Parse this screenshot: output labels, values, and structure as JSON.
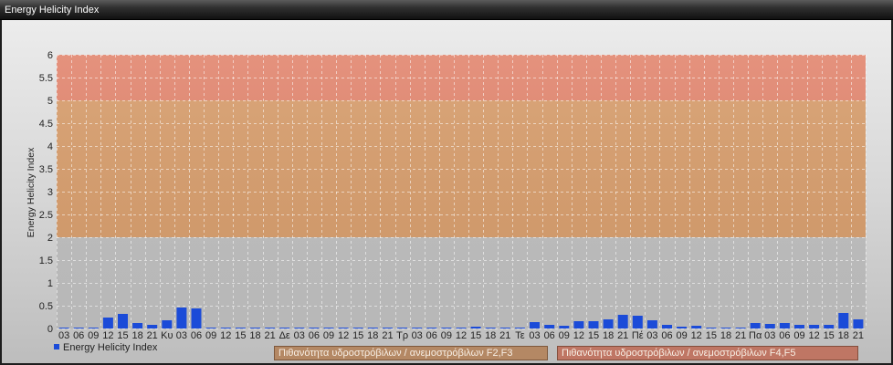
{
  "chart_data": {
    "type": "bar",
    "title": "Energy Helicity Index",
    "ylabel": "Energy Helicity Index",
    "ylim": [
      0,
      6
    ],
    "yticks": [
      0,
      0.5,
      1,
      1.5,
      2,
      2.5,
      3,
      3.5,
      4,
      4.5,
      5,
      5.5,
      6
    ],
    "categories": [
      "03",
      "06",
      "09",
      "12",
      "15",
      "18",
      "21",
      "Κυ",
      "03",
      "06",
      "09",
      "12",
      "15",
      "18",
      "21",
      "Δε",
      "03",
      "06",
      "09",
      "12",
      "15",
      "18",
      "21",
      "Τρ",
      "03",
      "06",
      "09",
      "12",
      "15",
      "18",
      "21",
      "Τε",
      "03",
      "06",
      "09",
      "12",
      "15",
      "18",
      "21",
      "Πέ",
      "03",
      "06",
      "09",
      "12",
      "15",
      "18",
      "21",
      "Πα",
      "03",
      "06",
      "09",
      "12",
      "15",
      "18",
      "21"
    ],
    "series": [
      {
        "name": "Energy Helicity Index",
        "color": "#1b4bd8",
        "values": [
          0.02,
          0.02,
          0.02,
          0.24,
          0.31,
          0.12,
          0.08,
          0.17,
          0.45,
          0.43,
          0.02,
          0.02,
          0.02,
          0.02,
          0.02,
          0.02,
          0.02,
          0.02,
          0.02,
          0.02,
          0.02,
          0.02,
          0.02,
          0.02,
          0.02,
          0.02,
          0.02,
          0.02,
          0.03,
          0.02,
          0.02,
          0.02,
          0.14,
          0.08,
          0.06,
          0.16,
          0.16,
          0.2,
          0.3,
          0.28,
          0.18,
          0.08,
          0.04,
          0.05,
          0.02,
          0.02,
          0.02,
          0.12,
          0.1,
          0.12,
          0.08,
          0.08,
          0.07,
          0.34,
          0.2
        ]
      }
    ],
    "bands": [
      {
        "from": 0,
        "to": 2,
        "color": "#c0c0c0"
      },
      {
        "from": 2,
        "to": 5,
        "color": "#d89e6d"
      },
      {
        "from": 5,
        "to": 6,
        "color": "#e2866f"
      }
    ],
    "grid": true,
    "legend": "bottom-left"
  },
  "annotations": [
    {
      "text": "Πιθανότητα υδροστρόβιλων / ανεμοστρόβιλων F2,F3",
      "color": "#b48864"
    },
    {
      "text": "Πιθανότητα υδροστρόβιλων / ανεμοστρόβιλων F4,F5",
      "color": "#bf7664"
    }
  ]
}
